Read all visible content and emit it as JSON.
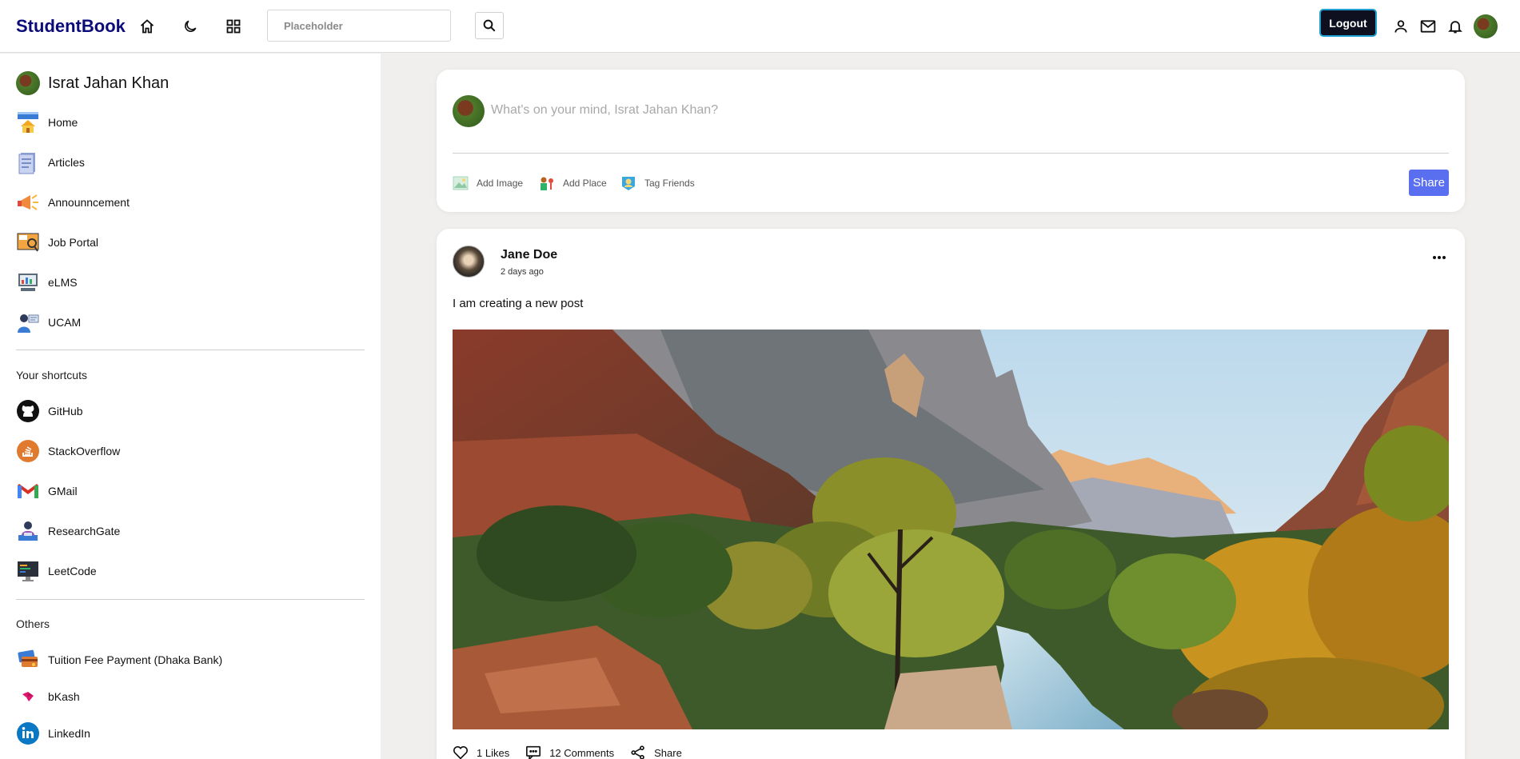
{
  "header": {
    "brand": "StudentBook",
    "search_placeholder": "Placeholder",
    "logout_label": "Logout",
    "icons": [
      "home-icon",
      "moon-icon",
      "grid-icon",
      "search-icon",
      "person-icon",
      "mail-icon",
      "bell-icon"
    ]
  },
  "sidebar": {
    "user_name": "Israt Jahan Khan",
    "main_items": [
      {
        "label": "Home",
        "icon": "home-app-icon"
      },
      {
        "label": "Articles",
        "icon": "articles-icon"
      },
      {
        "label": "Announncement",
        "icon": "megaphone-icon"
      },
      {
        "label": "Job Portal",
        "icon": "job-portal-icon"
      },
      {
        "label": "eLMS",
        "icon": "elms-icon"
      },
      {
        "label": "UCAM",
        "icon": "ucam-icon"
      }
    ],
    "shortcuts_heading": "Your shortcuts",
    "shortcuts": [
      {
        "label": "GitHub",
        "icon": "github-icon"
      },
      {
        "label": "StackOverflow",
        "icon": "stackoverflow-icon"
      },
      {
        "label": "GMail",
        "icon": "gmail-icon"
      },
      {
        "label": "ResearchGate",
        "icon": "researchgate-icon"
      },
      {
        "label": "LeetCode",
        "icon": "leetcode-icon"
      }
    ],
    "others_heading": "Others",
    "others": [
      {
        "label": "Tuition Fee Payment (Dhaka Bank)",
        "icon": "payment-icon"
      },
      {
        "label": "bKash",
        "icon": "bkash-icon"
      },
      {
        "label": "LinkedIn",
        "icon": "linkedin-icon"
      }
    ]
  },
  "composer": {
    "placeholder": "What's on your mind, Israt Jahan Khan?",
    "add_image": "Add Image",
    "add_place": "Add Place",
    "tag_friends": "Tag Friends",
    "share_label": "Share"
  },
  "post": {
    "author": "Jane Doe",
    "time": "2 days ago",
    "text": "I am creating a new post",
    "image_subject": "canyon landscape with river and autumn trees",
    "likes": "1 Likes",
    "comments": "12 Comments",
    "share": "Share"
  },
  "colors": {
    "brand": "#0b0b7a",
    "share_button": "#5a6ff0",
    "logout_button": "#0e1020",
    "page_background": "#f0efed"
  }
}
